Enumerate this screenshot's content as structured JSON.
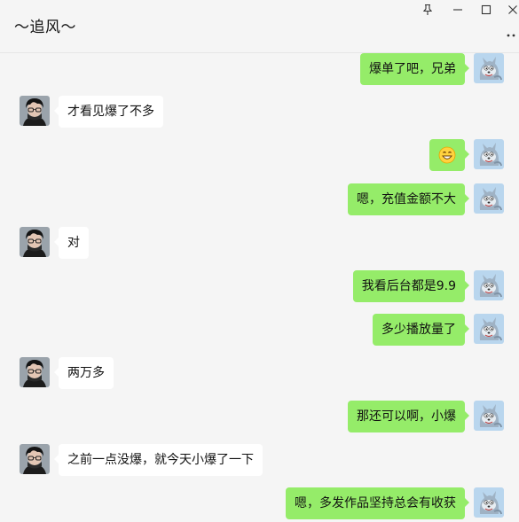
{
  "window": {
    "contact_name": "〜追风〜",
    "controls": {
      "pin_icon": "pin-icon",
      "minimize_icon": "minimize-icon",
      "maximize_icon": "maximize-icon",
      "close_icon": "close-icon",
      "more_icon": "more-options-icon"
    }
  },
  "colors": {
    "outgoing_bubble": "#95ec69",
    "incoming_bubble": "#ffffff",
    "background": "#f5f5f5"
  },
  "messages": [
    {
      "sender": "me",
      "text": "爆单了吧，兄弟"
    },
    {
      "sender": "other",
      "text": "才看见爆了不多"
    },
    {
      "sender": "me",
      "emoji": "grinning-face-emoji"
    },
    {
      "sender": "me",
      "text": "嗯，充值金额不大"
    },
    {
      "sender": "other",
      "text": "对"
    },
    {
      "sender": "me",
      "text": "我看后台都是9.9"
    },
    {
      "sender": "me",
      "text": "多少播放量了"
    },
    {
      "sender": "other",
      "text": "两万多"
    },
    {
      "sender": "me",
      "text": "那还可以啊，小爆"
    },
    {
      "sender": "other",
      "text": "之前一点没爆，就今天小爆了一下"
    },
    {
      "sender": "me",
      "text": "嗯，多发作品坚持总会有收获"
    }
  ]
}
